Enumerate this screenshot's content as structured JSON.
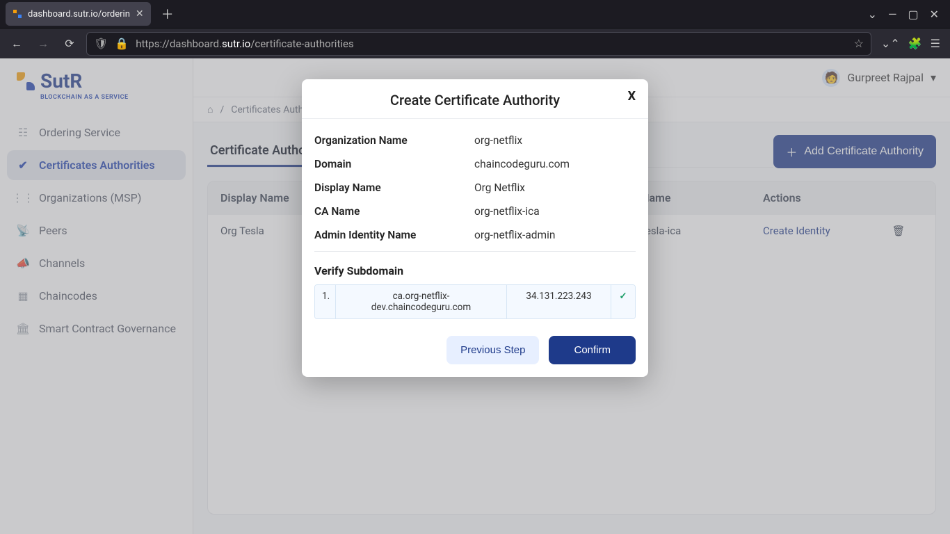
{
  "browser": {
    "tab_title": "dashboard.sutr.io/orderin",
    "url_display_prefix": "https://dashboard.",
    "url_display_host": "sutr.io",
    "url_display_suffix": "/certificate-authorities"
  },
  "brand": {
    "name": "SutR",
    "subtitle": "BLOCKCHAIN AS A SERVICE"
  },
  "sidebar": {
    "items": [
      {
        "label": "Ordering Service",
        "icon": "☷"
      },
      {
        "label": "Certificates Authorities",
        "icon": "✔"
      },
      {
        "label": "Organizations (MSP)",
        "icon": "⋮⋮"
      },
      {
        "label": "Peers",
        "icon": "📡"
      },
      {
        "label": "Channels",
        "icon": "📣"
      },
      {
        "label": "Chaincodes",
        "icon": "▦"
      },
      {
        "label": "Smart Contract Governance",
        "icon": "🏛"
      }
    ],
    "active_index": 1
  },
  "user": {
    "name": "Gurpreet Rajpal",
    "avatar_emoji": "🧑"
  },
  "breadcrumb": {
    "home": "⌂",
    "sep": "/",
    "current": "Certificates Authorities"
  },
  "page": {
    "tab_label": "Certificate Authorities",
    "add_button": "Add Certificate Authority"
  },
  "table": {
    "headers": {
      "display_name": "Display Name",
      "ca_name": "CA Name",
      "actions": "Actions"
    },
    "rows": [
      {
        "display_name": "Org Tesla",
        "ca_name": "org-tesla-ica",
        "action": "Create Identity"
      }
    ]
  },
  "modal": {
    "title": "Create Certificate Authority",
    "close": "X",
    "fields": {
      "org_name_label": "Organization Name",
      "org_name_value": "org-netflix",
      "domain_label": "Domain",
      "domain_value": "chaincodeguru.com",
      "display_name_label": "Display Name",
      "display_name_value": "Org Netflix",
      "ca_name_label": "CA Name",
      "ca_name_value": "org-netflix-ica",
      "admin_label": "Admin Identity Name",
      "admin_value": "org-netflix-admin"
    },
    "verify": {
      "title": "Verify Subdomain",
      "row": {
        "index": "1.",
        "subdomain": "ca.org-netflix-dev.chaincodeguru.com",
        "ip": "34.131.223.243",
        "status": "✓"
      }
    },
    "buttons": {
      "prev": "Previous Step",
      "confirm": "Confirm"
    }
  }
}
